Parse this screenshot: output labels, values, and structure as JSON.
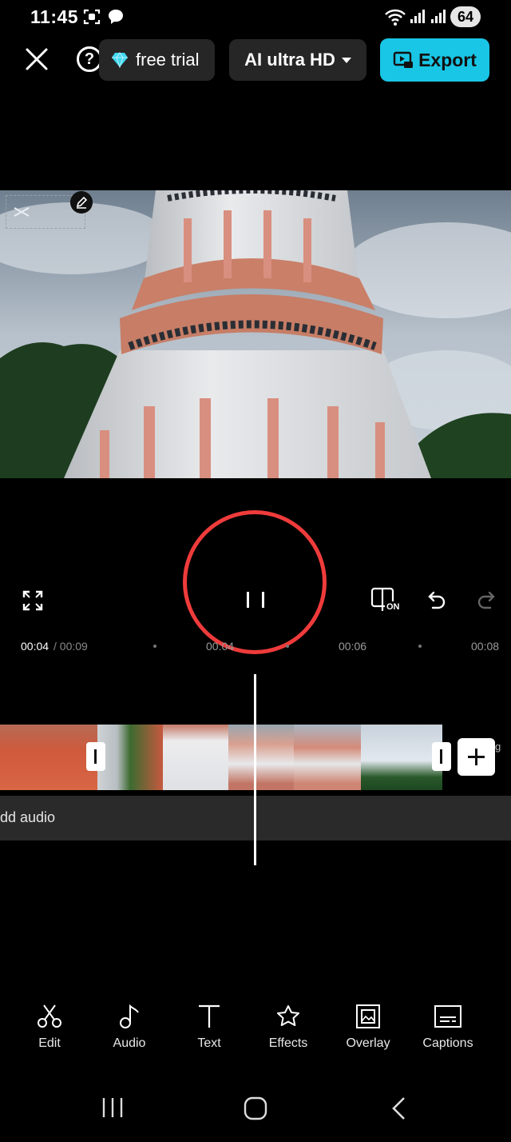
{
  "status_bar": {
    "time": "11:45",
    "battery": "64"
  },
  "toolbar": {
    "trial_label": "free trial",
    "quality_label": "AI ultra HD",
    "export_label": "Export"
  },
  "colors": {
    "accent": "#19c6e6",
    "annotation": "#ef3b3b",
    "background": "#000000",
    "panel": "#262626"
  },
  "playback": {
    "current_time": "00:04",
    "total_time": "/ 00:09",
    "ruler_labels": [
      "00:04",
      "00:06",
      "00:08"
    ],
    "compare_badge": "ON"
  },
  "timeline": {
    "add_audio_label": "dd audio",
    "cover_label": "g"
  },
  "tools": [
    {
      "label": "Edit",
      "icon": "scissors-icon"
    },
    {
      "label": "Audio",
      "icon": "music-note-icon"
    },
    {
      "label": "Text",
      "icon": "text-icon"
    },
    {
      "label": "Effects",
      "icon": "effects-star-icon"
    },
    {
      "label": "Overlay",
      "icon": "overlay-icon"
    },
    {
      "label": "Captions",
      "icon": "captions-icon"
    }
  ],
  "nav": {
    "recent": "recent-apps-icon",
    "home": "home-icon",
    "back": "back-icon"
  }
}
